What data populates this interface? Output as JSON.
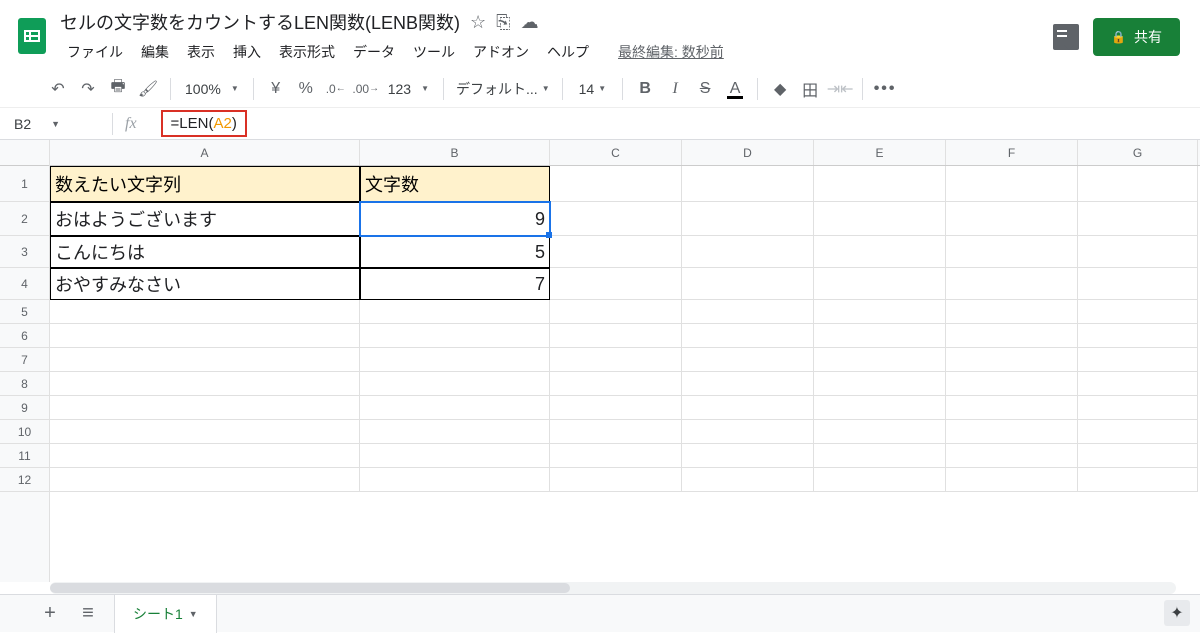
{
  "doc": {
    "title": "セルの文字数をカウントするLEN関数(LENB関数)"
  },
  "menu": {
    "items": [
      "ファイル",
      "編集",
      "表示",
      "挿入",
      "表示形式",
      "データ",
      "ツール",
      "アドオン",
      "ヘルプ"
    ],
    "last_edit": "最終編集: 数秒前"
  },
  "share_label": "共有",
  "toolbar": {
    "zoom": "100%",
    "currency": "¥",
    "percent": "%",
    "dec_dec": ".0",
    "inc_dec": ".00",
    "numfmt": "123",
    "font_name": "デフォルト...",
    "font_size": "14",
    "bold": "B",
    "italic": "I",
    "strike": "S",
    "text_color": "A",
    "more": "•••"
  },
  "formula": {
    "name_box": "B2",
    "fx": "fx",
    "prefix": "=LEN(",
    "ref": "A2",
    "suffix": ")"
  },
  "columns": [
    "A",
    "B",
    "C",
    "D",
    "E",
    "F",
    "G"
  ],
  "rows": [
    "1",
    "2",
    "3",
    "4",
    "5",
    "6",
    "7",
    "8",
    "9",
    "10",
    "11",
    "12"
  ],
  "cells": {
    "A1": "数えたい文字列",
    "B1": "文字数",
    "A2": "おはようございます",
    "B2": "9",
    "A3": "こんにちは",
    "B3": "5",
    "A4": "おやすみなさい",
    "B4": "7"
  },
  "tabs": {
    "sheet1": "シート1"
  }
}
